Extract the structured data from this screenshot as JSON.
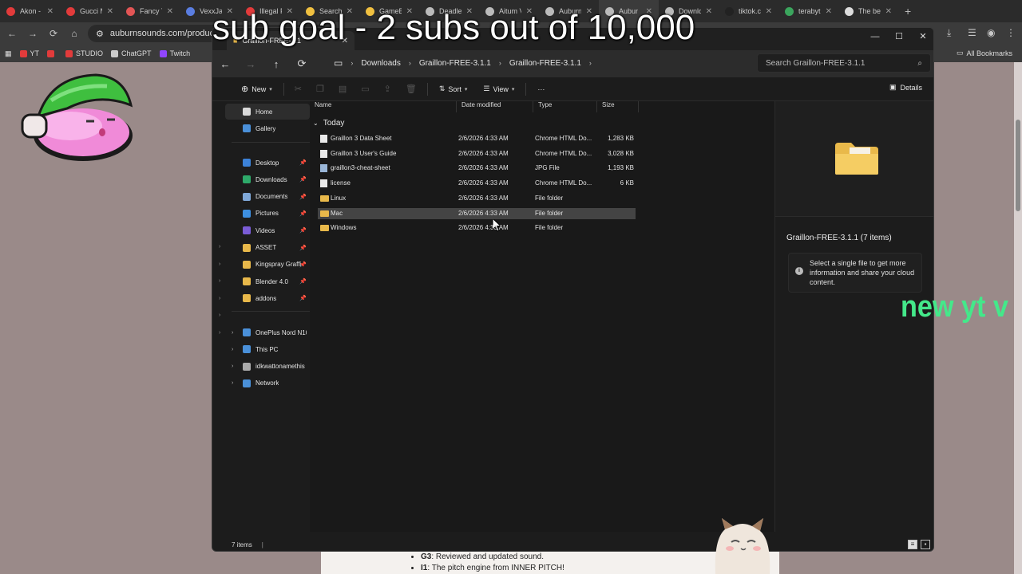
{
  "browser": {
    "tabs": [
      {
        "label": "Akon -",
        "color": "#e23b3b"
      },
      {
        "label": "Gucci M",
        "color": "#e23b3b"
      },
      {
        "label": "Fancy Ta",
        "color": "#e25555"
      },
      {
        "label": "VexxJa",
        "color": "#5a7de0"
      },
      {
        "label": "Illegal F",
        "color": "#e23b3b"
      },
      {
        "label": "Search",
        "color": "#f0c040"
      },
      {
        "label": "GameB",
        "color": "#f0c040"
      },
      {
        "label": "Deadle",
        "color": "#bbbbbb"
      },
      {
        "label": "Aitum V",
        "color": "#bbbbbb"
      },
      {
        "label": "Auburn",
        "color": "#bbbbbb"
      },
      {
        "label": "Aubur",
        "color": "#bbbbbb"
      },
      {
        "label": "Downlo",
        "color": "#bbbbbb"
      },
      {
        "label": "tiktok.c",
        "color": "#222222"
      },
      {
        "label": "terabyt",
        "color": "#3ba55d"
      },
      {
        "label": "The be",
        "color": "#dddddd"
      }
    ],
    "tab_close": "✕",
    "new_tab": "+",
    "url": "auburnsounds.com/products/Gra",
    "bookmarks": [
      {
        "label": "YT",
        "color": "#e23b3b"
      },
      {
        "label": "",
        "color": "#e23b3b"
      },
      {
        "label": "STUDIO",
        "color": "#e23b3b"
      },
      {
        "label": "ChatGPT",
        "color": "#cccccc"
      },
      {
        "label": "Twitch",
        "color": "#9146ff"
      }
    ],
    "all_bookmarks": "All Bookmarks"
  },
  "page_bottom": {
    "items": [
      {
        "key": "G3",
        "text": ": Reviewed and updated sound."
      },
      {
        "key": "I1",
        "text": ": The pitch engine from INNER PITCH!"
      }
    ],
    "side_number": "37"
  },
  "overlay": {
    "title": "sub goal - 2 subs out of 10,000",
    "ticker": "new yt vi"
  },
  "explorer": {
    "tab_title": "Graillon-FREE-3.1",
    "breadcrumbs": [
      "Downloads",
      "Graillon-FREE-3.1.1",
      "Graillon-FREE-3.1.1"
    ],
    "search_placeholder": "Search Graillon-FREE-3.1.1",
    "commands": {
      "new": "New",
      "sort": "Sort",
      "view": "View",
      "more": "···",
      "details": "Details"
    },
    "sidebar": {
      "home": "Home",
      "gallery": "Gallery",
      "pinned": [
        {
          "label": "Desktop",
          "color": "#3c82d8"
        },
        {
          "label": "Downloads",
          "color": "#2eaa6a"
        },
        {
          "label": "Documents",
          "color": "#7fa8d8"
        },
        {
          "label": "Pictures",
          "color": "#3d8fe0"
        },
        {
          "label": "Videos",
          "color": "#7a5cd6"
        },
        {
          "label": "ASSET",
          "color": "#e8b84a"
        },
        {
          "label": "Kingspray Graffi",
          "color": "#e8b84a"
        },
        {
          "label": "Blender 4.0",
          "color": "#e8b84a"
        },
        {
          "label": "addons",
          "color": "#e8b84a"
        }
      ],
      "drives": [
        {
          "label": "OnePlus Nord N10",
          "color": "#4a90d9"
        },
        {
          "label": "This PC",
          "color": "#4a90d9"
        },
        {
          "label": "idkwattonamethis (",
          "color": "#aaaaaa"
        },
        {
          "label": "Network",
          "color": "#4a90d9"
        }
      ]
    },
    "columns": {
      "name": "Name",
      "date": "Date modified",
      "type": "Type",
      "size": "Size"
    },
    "group": "Today",
    "files": [
      {
        "name": "Graillon 3 Data Sheet",
        "date": "2/6/2026 4:33 AM",
        "type": "Chrome HTML Do...",
        "size": "1,283 KB",
        "icon": "html"
      },
      {
        "name": "Graillon 3 User's Guide",
        "date": "2/6/2026 4:33 AM",
        "type": "Chrome HTML Do...",
        "size": "3,028 KB",
        "icon": "html"
      },
      {
        "name": "graillon3-cheat-sheet",
        "date": "2/6/2026 4:33 AM",
        "type": "JPG File",
        "size": "1,193 KB",
        "icon": "jpg"
      },
      {
        "name": "license",
        "date": "2/6/2026 4:33 AM",
        "type": "Chrome HTML Do...",
        "size": "6 KB",
        "icon": "html"
      },
      {
        "name": "Linux",
        "date": "2/6/2026 4:33 AM",
        "type": "File folder",
        "size": "",
        "icon": "folder"
      },
      {
        "name": "Mac",
        "date": "2/6/2026 4:33 AM",
        "type": "File folder",
        "size": "",
        "icon": "folder"
      },
      {
        "name": "Windows",
        "date": "2/6/2026 4:33 AM",
        "type": "File folder",
        "size": "",
        "icon": "folder"
      }
    ],
    "selected_index": 5,
    "details": {
      "title": "Graillon-FREE-3.1.1 (7 items)",
      "info": "Select a single file to get more information and share your cloud content."
    },
    "status": "7 items",
    "status_sep": "|"
  }
}
